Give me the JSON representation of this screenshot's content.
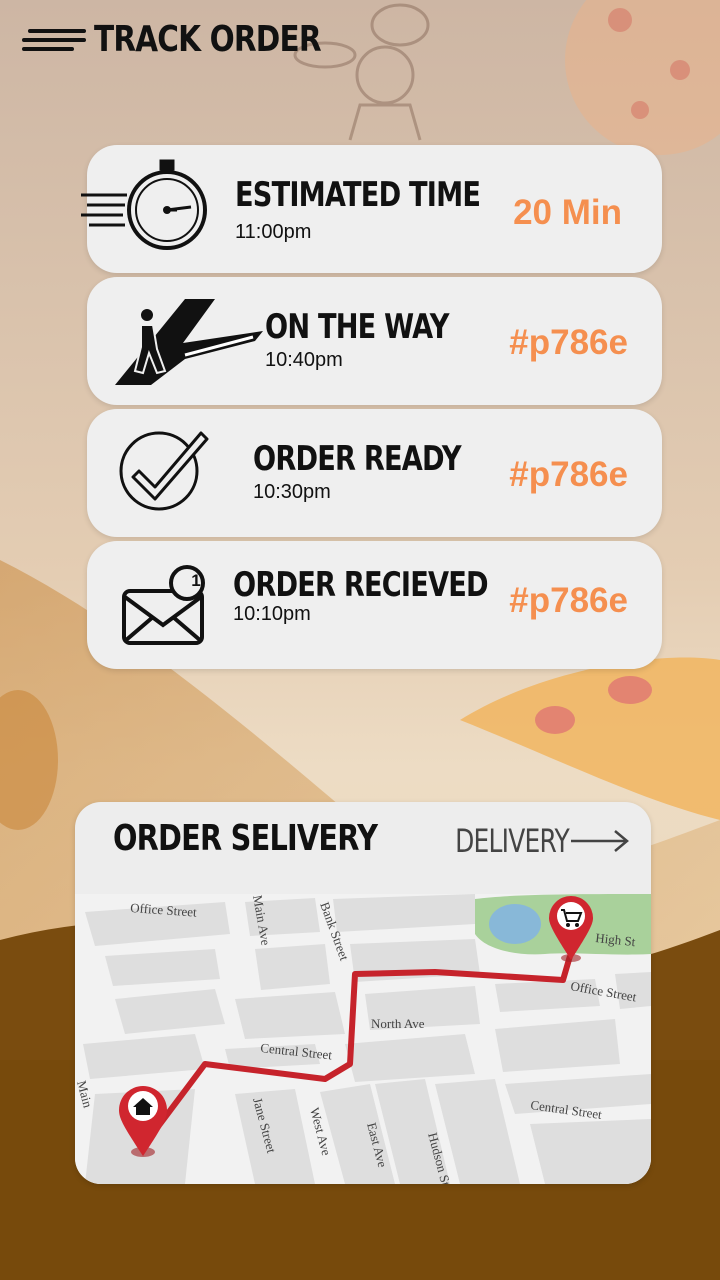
{
  "header": {
    "title": "TRACK ORDER",
    "menu_icon": "hamburger-menu-icon"
  },
  "steps": [
    {
      "title": "ESTIMATED TIME",
      "time": "11:00pm",
      "value": "20 Min",
      "icon": "stopwatch-icon"
    },
    {
      "title": "ON THE WAY",
      "time": "10:40pm",
      "value": "#p786e",
      "icon": "courier-walking-icon"
    },
    {
      "title": "ORDER READY",
      "time": "10:30pm",
      "value": "#p786e",
      "icon": "check-circle-icon"
    },
    {
      "title": "ORDER RECIEVED",
      "time": "10:10pm",
      "value": "#p786e",
      "icon": "envelope-notification-icon"
    }
  ],
  "notification_count": "1",
  "delivery": {
    "title": "ORDER SELIVERY",
    "link_label": "DELIVERY",
    "map": {
      "streets": [
        "Office Street",
        "Bank Street",
        "Main Ave",
        "North Ave",
        "Central Street",
        "Central Street",
        "Jane Street",
        "West Ave",
        "East Ave",
        "Hudson St",
        "High St",
        "Office Street",
        "Main"
      ]
    }
  },
  "colors": {
    "accent": "#f58f4f",
    "route": "#c6232b",
    "card": "#efefef"
  }
}
